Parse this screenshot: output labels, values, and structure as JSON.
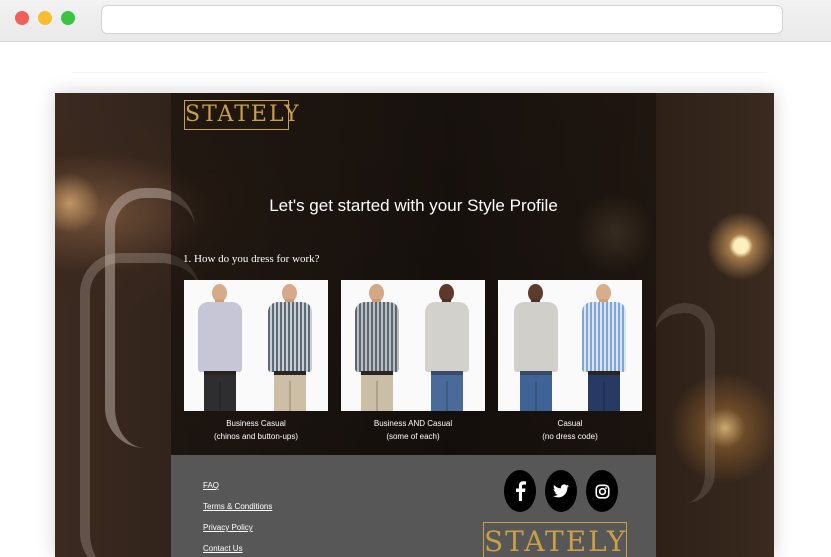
{
  "brand": {
    "name": "STATELY",
    "color": "#c9a046"
  },
  "hero": {
    "title": "Let's get started with your Style Profile"
  },
  "question": {
    "text": "1. How do you dress for work?"
  },
  "options": [
    {
      "line1": "Business Casual",
      "line2": "(chinos and button-ups)"
    },
    {
      "line1": "Business AND Casual",
      "line2": "(some of each)"
    },
    {
      "line1": "Casual",
      "line2": "(no dress code)"
    }
  ],
  "footer": {
    "links": [
      "FAQ",
      "Terms & Conditions",
      "Privacy Policy",
      "Contact Us"
    ],
    "social": [
      "facebook-icon",
      "twitter-icon",
      "instagram-icon"
    ]
  }
}
